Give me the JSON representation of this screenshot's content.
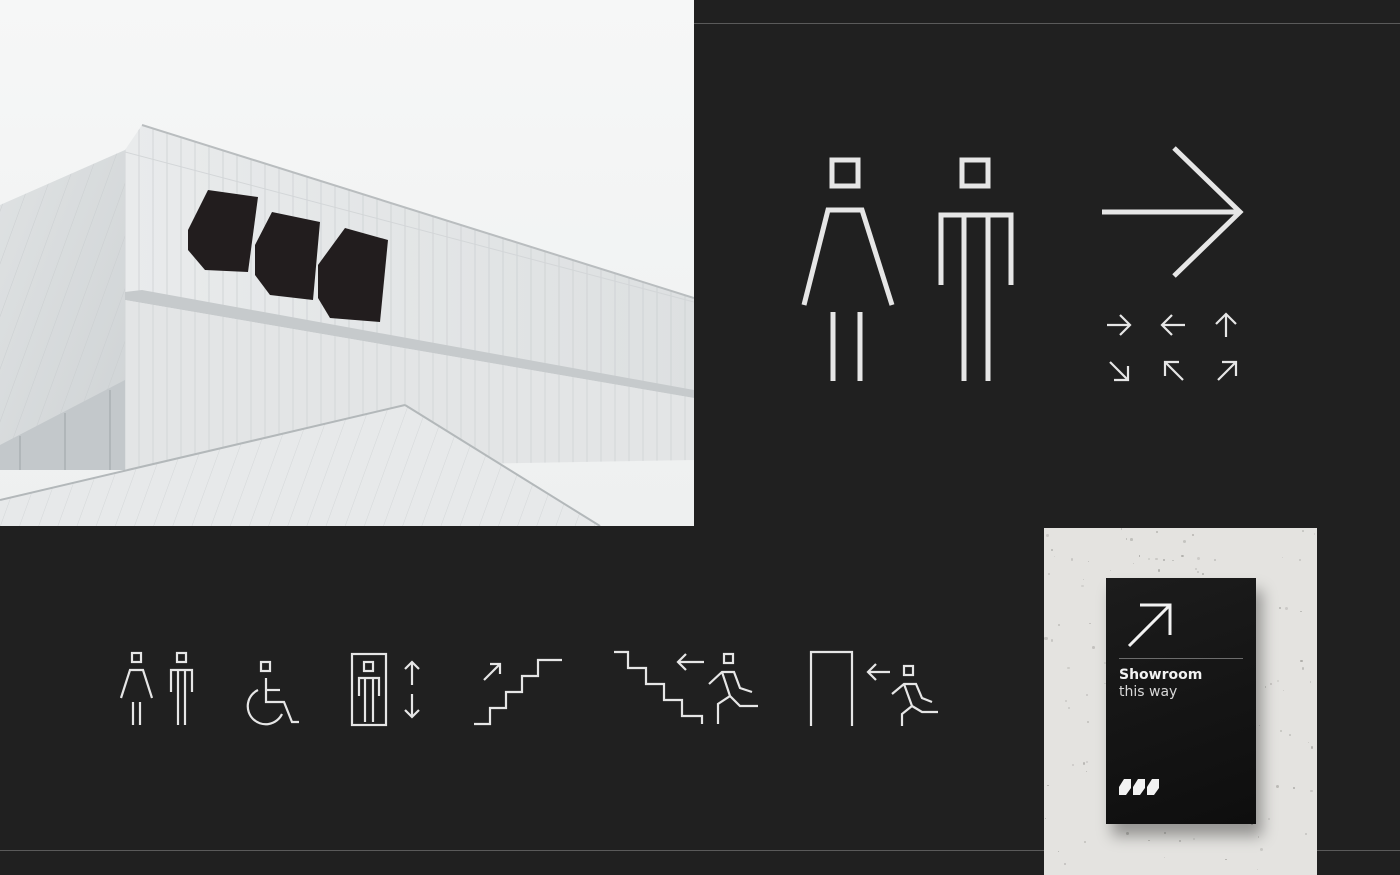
{
  "colors": {
    "background": "#202020",
    "pictogram_stroke": "#e6e6e6",
    "sign_face": "#111111",
    "concrete_panel": "#e4e3e0",
    "logo_panels": "#221d1e"
  },
  "photo": {
    "subject": "building-facade",
    "logo": "m-logo"
  },
  "pictograms_large": [
    "female-toilet-icon",
    "male-toilet-icon",
    "arrow-right-icon"
  ],
  "arrow_set": [
    "arrow-right-icon",
    "arrow-left-icon",
    "arrow-up-icon",
    "arrow-down-right-icon",
    "arrow-up-left-icon",
    "arrow-up-right-icon"
  ],
  "pictograms_row": [
    "toilets-icon",
    "accessible-icon",
    "elevator-icon",
    "stairs-up-icon",
    "stairs-exit-icon",
    "door-exit-icon"
  ],
  "sign": {
    "title": "Showroom",
    "subtitle": "this way",
    "arrow": "arrow-up-right-icon",
    "logo": "m-logo"
  }
}
